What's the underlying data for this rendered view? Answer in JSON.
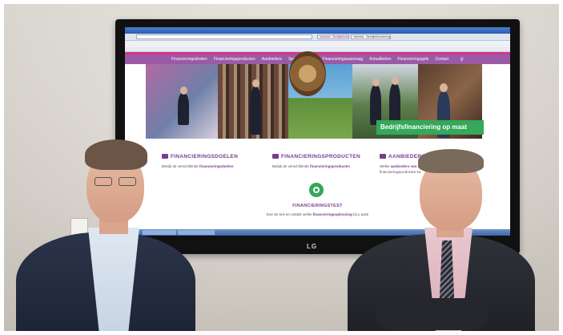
{
  "browser": {
    "tab_1": "Vakbank - Bedrijfsfinanciering",
    "tab_2": "Vakbank - Bedrijfsfinanciering"
  },
  "site": {
    "nav": [
      "Financieringsdoelen",
      "Financieringsproducten",
      "Aanbieders",
      "Speciale routes",
      "Financieringsaanvraag",
      "Actualiteiten",
      "Financieringsgids",
      "Contact"
    ],
    "banner": "Bedrijfsfinanciering op maat",
    "columns": [
      {
        "title": "FINANCIERINGSDOELEN",
        "desc_pre": "Bekijk de verschillende ",
        "desc_bold": "financieringsdoelen"
      },
      {
        "title": "FINANCIERINGSPRODUCTEN",
        "desc_pre": "Bekijk de verschillende ",
        "desc_bold": "financieringsproducten"
      },
      {
        "title": "AANBIEDERS",
        "desc_pre": "Welke ",
        "desc_bold": "aanbieders van fi",
        "desc_post": "financieringsproducten ka"
      }
    ],
    "test": {
      "title": "FINANCIERINGSTEST",
      "desc_pre": "Doe de test en ontdek welke ",
      "desc_bold": "financieringsoplossing",
      "desc_post": " bij u past!"
    }
  },
  "tv": {
    "brand": "LG"
  },
  "colors": {
    "brand_purple": "#9b5aa6",
    "accent_pink": "#d6338a",
    "accent_green": "#35a85a"
  }
}
